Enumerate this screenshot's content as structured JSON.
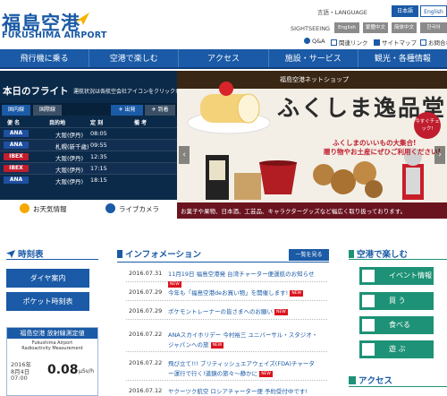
{
  "header": {
    "logo_jp": "福島空港",
    "logo_en": "FUKUSHIMA AIRPORT",
    "language_label": "言語・LANGUAGE",
    "lang_ja": "日本語",
    "lang_en": "English",
    "sightseeing_label": "SIGHTSEEING",
    "sight_buttons": [
      "English",
      "繁體中文",
      "简体中文",
      "한국어"
    ],
    "util_links": [
      "Q&A",
      "関連リンク",
      "サイトマップ",
      "お問合わ"
    ]
  },
  "nav": [
    "飛行機に乗る",
    "空港で楽しむ",
    "アクセス",
    "施設・サービス",
    "観光・各種情報"
  ],
  "flights": {
    "title": "本日のフライト",
    "note": "運航状況は各航空会社アイコンをクリック!",
    "tabs": {
      "domestic": "国内線",
      "international": "国際線",
      "departure": "出発",
      "arrival": "到着"
    },
    "headers": {
      "airline": "便 名",
      "dest": "目的地",
      "time": "定 刻",
      "remarks": "備 考"
    },
    "rows": [
      {
        "airline": "ANA",
        "dest": "大阪(伊丹)",
        "time": "08:05",
        "carrier": "ana"
      },
      {
        "airline": "ANA",
        "dest": "札幌(新千歳)",
        "time": "09:55",
        "carrier": "ana"
      },
      {
        "airline": "IBEX",
        "dest": "大阪(伊丹)",
        "time": "12:35",
        "carrier": "ibex"
      },
      {
        "airline": "IBEX",
        "dest": "大阪(伊丹)",
        "time": "17:15",
        "carrier": "ibex"
      },
      {
        "airline": "ANA",
        "dest": "大阪(伊丹)",
        "time": "18:15",
        "carrier": "ana"
      }
    ],
    "weather_btn": "お天気情報",
    "livecam_btn": "ライブカメラ"
  },
  "banner": {
    "shop_label": "福島空港ネットショップ",
    "big_text": "ふくしま逸品堂",
    "sub1": "ふくしまのいいもの大集合!",
    "sub2": "贈り物やお土産にぜひご利用ください!",
    "badge": "今すぐチェック!",
    "caption": "お菓子や果物、日本酒、工芸品、キャラクターグッズなど幅広く取り扱っております。"
  },
  "left": {
    "timetable_title": "時刻表",
    "dia_btn": "ダイヤ案内",
    "pocket_btn": "ポケット時刻表",
    "rad_title": "福島空港 放射線測定値",
    "rad_sub1": "Fukushima Airport",
    "rad_sub2": "Radioactivity Measurement",
    "rad_date1": "2016年",
    "rad_date2": "8月4日",
    "rad_date3": "07:00",
    "rad_value": "0.08",
    "rad_unit": "μSv/h"
  },
  "info": {
    "title": "インフォメーション",
    "list_btn": "一覧を見る",
    "items": [
      {
        "date": "2016.07.31",
        "title": "11月19日 福島空港発 台湾チャーター便運航のお知らせ"
      },
      {
        "date": "2016.07.29",
        "title": "今年も「福島空港deお買い物」を開催します!"
      },
      {
        "date": "2016.07.29",
        "title": "ポケモントレーナーの皆さまへのお願い"
      },
      {
        "date": "2016.07.22",
        "title": "ANAスカイホリデー 今村裕三 ユニバーサル・スタジオ・ジャパンへの旅"
      },
      {
        "date": "2016.07.22",
        "title": "飛び立て!!! ブリティッシュエアウェイズ(FDA)チャーター運行で行く!道鏡の旅々～静かに"
      },
      {
        "date": "2016.07.12",
        "title": "ヤクーツク航空 ロシアチャーター便 予約受付中です!"
      }
    ]
  },
  "right": {
    "title": "空港で楽しむ",
    "buttons": [
      "イベント情報",
      "買 う",
      "食べる",
      "遊 ぶ"
    ],
    "access_title": "アクセス"
  }
}
